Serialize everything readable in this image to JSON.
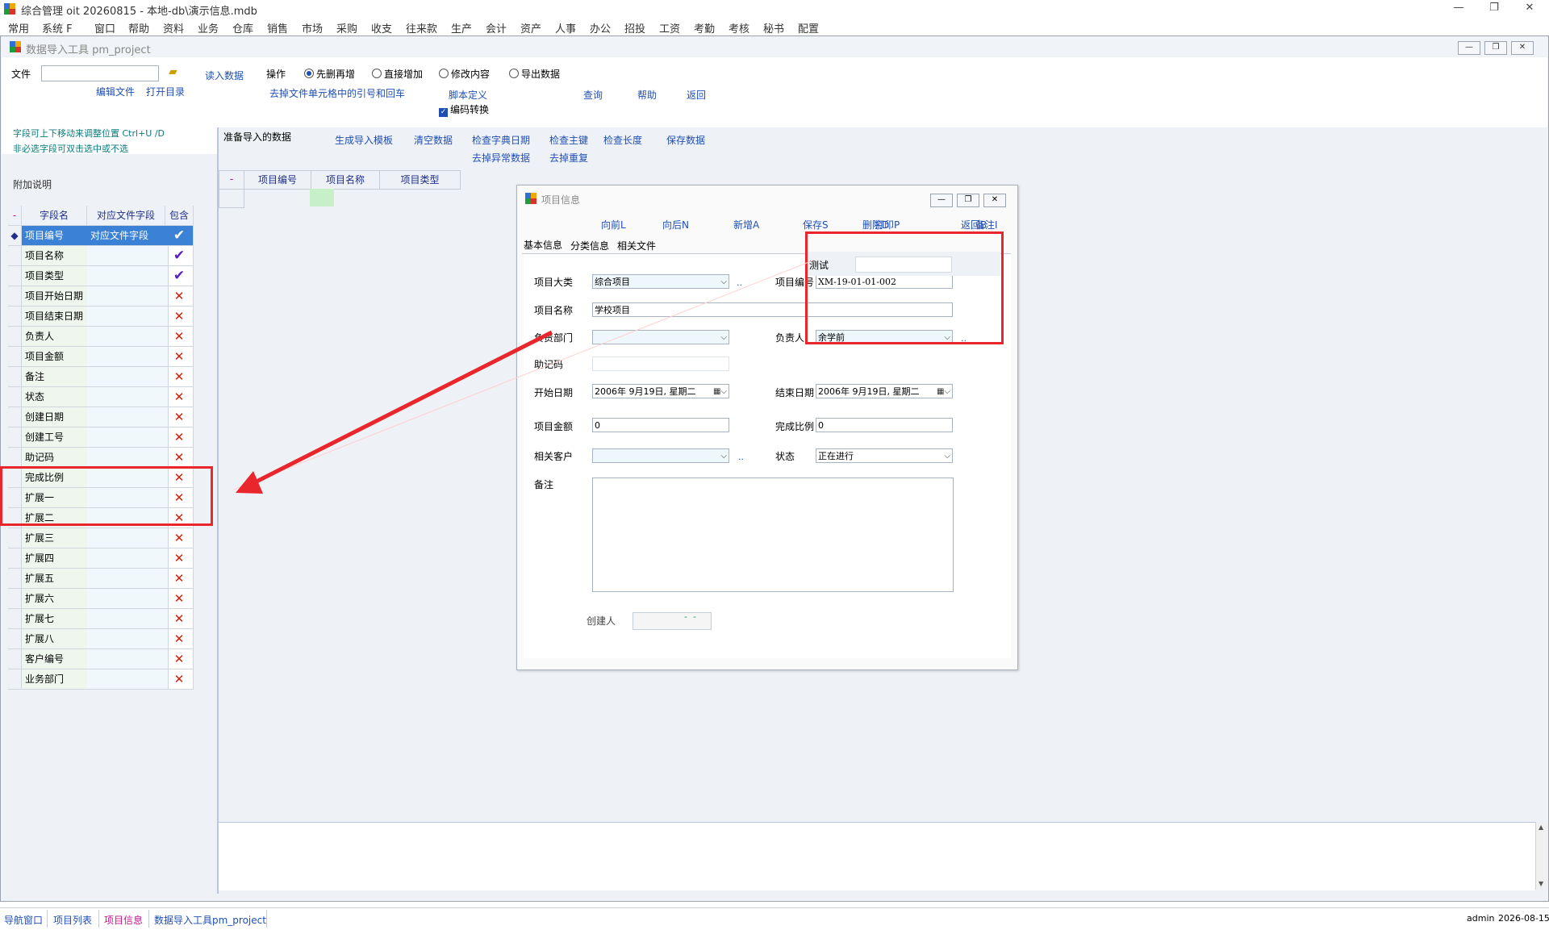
{
  "app": {
    "title": "综合管理 oit 20260815 - 本地-db\\演示信息.mdb",
    "window_controls": {
      "minimize": "—",
      "restore": "❐",
      "close": "✕"
    }
  },
  "menu": [
    "常用",
    "系统 F",
    "窗口",
    "帮助",
    "资料",
    "业务",
    "仓库",
    "销售",
    "市场",
    "采购",
    "收支",
    "往来款",
    "生产",
    "会计",
    "资产",
    "人事",
    "办公",
    "招投",
    "工资",
    "考勤",
    "考核",
    "秘书",
    "配置"
  ],
  "tool": {
    "title": "数据导入工具 pm_project",
    "file_label": "文件",
    "file_value": "",
    "read_data": "读入数据",
    "operation_label": "操作",
    "radios": [
      {
        "label": "先删再增",
        "checked": true
      },
      {
        "label": "直接增加",
        "checked": false
      },
      {
        "label": "修改内容",
        "checked": false
      },
      {
        "label": "导出数据",
        "checked": false
      }
    ],
    "edit_file": "编辑文件",
    "open_dir": "打开目录",
    "strip_quotes": "去掉文件单元格中的引号和回车",
    "script_def": "脚本定义",
    "encoding_convert": "编码转换",
    "query": "查询",
    "help": "帮助",
    "back": "返回",
    "hint1": "字段可上下移动来调整位置 Ctrl+U /D",
    "hint2": "非必选字段可双击选中或不选",
    "extra_note": "附加说明",
    "prepare_title": "准备导入的数据",
    "actions_row1": [
      "生成导入模板",
      "清空数据",
      "检查字典日期",
      "检查主键",
      "检查长度",
      "保存数据"
    ],
    "actions_row2": [
      "去掉异常数据",
      "去掉重复"
    ],
    "preview_headers": [
      "-",
      "项目编号",
      "项目名称",
      "项目类型"
    ]
  },
  "field_grid": {
    "headers": [
      "-",
      "字段名",
      "对应文件字段",
      "包含"
    ],
    "rows": [
      {
        "name": "项目编号",
        "mapped": "对应文件字段",
        "include": true,
        "selected": true
      },
      {
        "name": "项目名称",
        "mapped": "",
        "include": true
      },
      {
        "name": "项目类型",
        "mapped": "",
        "include": true
      },
      {
        "name": "项目开始日期",
        "mapped": "",
        "include": false
      },
      {
        "name": "项目结束日期",
        "mapped": "",
        "include": false
      },
      {
        "name": "负责人",
        "mapped": "",
        "include": false
      },
      {
        "name": "项目金额",
        "mapped": "",
        "include": false
      },
      {
        "name": "备注",
        "mapped": "",
        "include": false
      },
      {
        "name": "状态",
        "mapped": "",
        "include": false
      },
      {
        "name": "创建日期",
        "mapped": "",
        "include": false
      },
      {
        "name": "创建工号",
        "mapped": "",
        "include": false
      },
      {
        "name": "助记码",
        "mapped": "",
        "include": false
      },
      {
        "name": "完成比例",
        "mapped": "",
        "include": false
      },
      {
        "name": "扩展一",
        "mapped": "",
        "include": false
      },
      {
        "name": "扩展二",
        "mapped": "",
        "include": false
      },
      {
        "name": "扩展三",
        "mapped": "",
        "include": false
      },
      {
        "name": "扩展四",
        "mapped": "",
        "include": false
      },
      {
        "name": "扩展五",
        "mapped": "",
        "include": false
      },
      {
        "name": "扩展六",
        "mapped": "",
        "include": false
      },
      {
        "name": "扩展七",
        "mapped": "",
        "include": false
      },
      {
        "name": "扩展八",
        "mapped": "",
        "include": false
      },
      {
        "name": "客户编号",
        "mapped": "",
        "include": false
      },
      {
        "name": "业务部门",
        "mapped": "",
        "include": false
      }
    ],
    "marks": {
      "include": "✔",
      "exclude": "✕",
      "selected": "◆"
    }
  },
  "dialog": {
    "title": "项目信息",
    "toolbar": [
      "向前L",
      "向后N",
      "新增A",
      "保存S",
      "删除D",
      "备注I",
      "打印P",
      "返回B"
    ],
    "tabs": [
      "基本信息",
      "分类信息",
      "相关文件"
    ],
    "fields": {
      "category_label": "项目大类",
      "category_value": "综合项目",
      "code_label": "项目编号",
      "code_value": "XM-19-01-01-002",
      "name_label": "项目名称",
      "name_value": "学校项目",
      "dept_label": "负责部门",
      "dept_value": "",
      "owner_label": "负责人",
      "owner_value": "余学前",
      "mnemonic_label": "助记码",
      "mnemonic_value": "",
      "start_label": "开始日期",
      "start_value": "2006年 9月19日, 星期二",
      "end_label": "结束日期",
      "end_value": "2006年 9月19日, 星期二",
      "amount_label": "项目金额",
      "amount_value": "0",
      "ratio_label": "完成比例",
      "ratio_value": "0",
      "customer_label": "相关客户",
      "customer_value": "",
      "status_label": "状态",
      "status_value": "正在进行",
      "remark_label": "备注",
      "remark_value": "",
      "creator_label": "创建人",
      "creator_value": "",
      "dots": "..",
      "dashes": "-  -",
      "test_label": "测试",
      "test_value": ""
    }
  },
  "statusbar": {
    "tabs": [
      "导航窗口",
      "项目列表",
      "项目信息",
      "数据导入工具pm_project"
    ],
    "user": "admin",
    "date": "2026-08-15"
  },
  "colors": {
    "accent": "#1f4fb5",
    "annotation": "#e8262b",
    "active_tab": "#c0178f"
  }
}
